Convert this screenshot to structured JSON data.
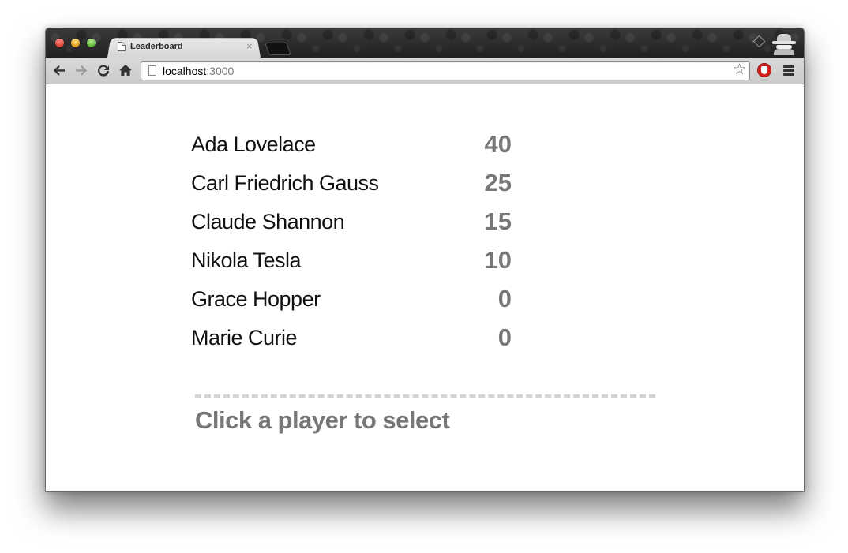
{
  "browser": {
    "tab": {
      "title": "Leaderboard",
      "close_glyph": "×"
    },
    "address_bar": {
      "host": "localhost",
      "port": ":3000"
    },
    "toolbar_icons": [
      "back-arrow-icon",
      "forward-arrow-icon",
      "reload-icon",
      "home-icon",
      "bookmark-star-icon",
      "adblock-icon",
      "menu-icon"
    ],
    "star_glyph": "☆"
  },
  "leaderboard": {
    "players": [
      {
        "name": "Ada Lovelace",
        "score": "40"
      },
      {
        "name": "Carl Friedrich Gauss",
        "score": "25"
      },
      {
        "name": "Claude Shannon",
        "score": "15"
      },
      {
        "name": "Nikola Tesla",
        "score": "10"
      },
      {
        "name": "Grace Hopper",
        "score": "0"
      },
      {
        "name": "Marie Curie",
        "score": "0"
      }
    ],
    "prompt": "Click a player to select"
  },
  "colors": {
    "score": "#777777",
    "name": "#111111",
    "divider": "#d4d4d4"
  }
}
